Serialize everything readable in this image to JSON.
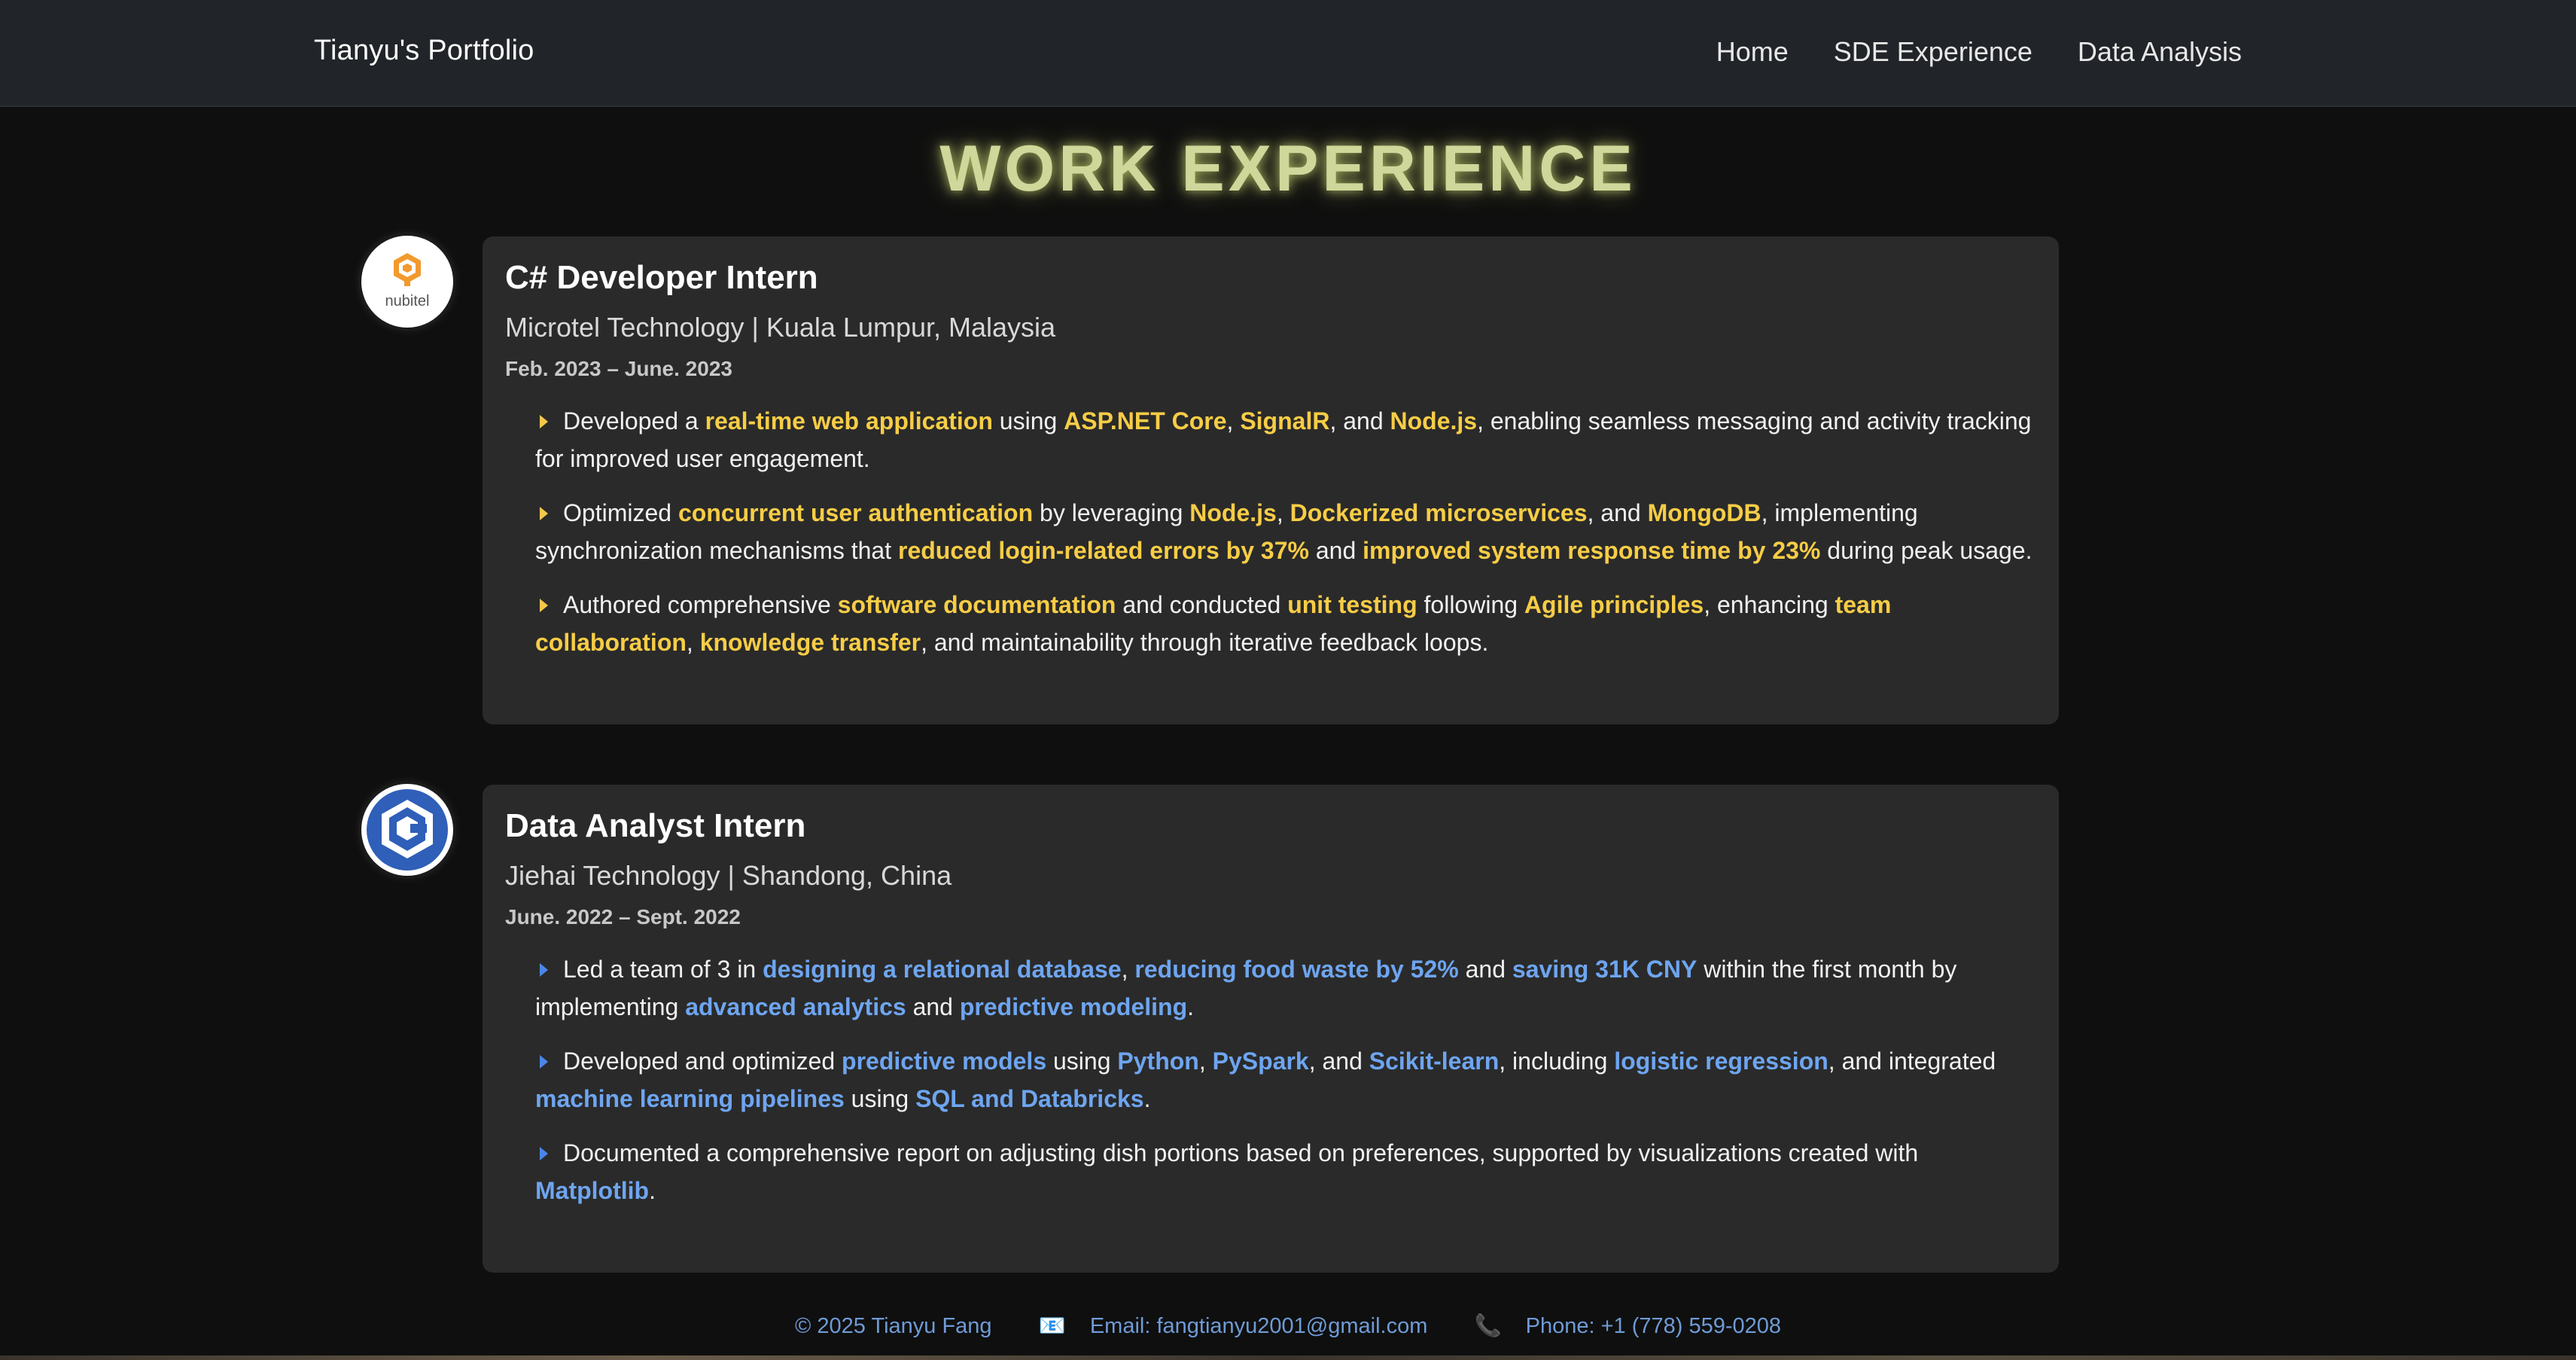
{
  "navbar": {
    "brand": "Tianyu's Portfolio",
    "links": [
      "Home",
      "SDE Experience",
      "Data Analysis"
    ]
  },
  "page": {
    "title": "WORK EXPERIENCE"
  },
  "jobs": [
    {
      "role": "C# Developer Intern",
      "company": "Microtel Technology | Kuala Lumpur, Malaysia",
      "dates": "Feb. 2023 – June. 2023",
      "logo_text": "nubitel",
      "accent": "#f7cd46",
      "bullets": [
        [
          {
            "t": "Developed a "
          },
          {
            "t": "real-time web application",
            "h": 1
          },
          {
            "t": " using "
          },
          {
            "t": "ASP.NET Core",
            "h": 1
          },
          {
            "t": ", "
          },
          {
            "t": "SignalR",
            "h": 1
          },
          {
            "t": ", and "
          },
          {
            "t": "Node.js",
            "h": 1
          },
          {
            "t": ", enabling seamless messaging and activity tracking for improved user engagement."
          }
        ],
        [
          {
            "t": "Optimized "
          },
          {
            "t": "concurrent user authentication",
            "h": 1
          },
          {
            "t": " by leveraging "
          },
          {
            "t": "Node.js",
            "h": 1
          },
          {
            "t": ", "
          },
          {
            "t": "Dockerized microservices",
            "h": 1
          },
          {
            "t": ", and "
          },
          {
            "t": "MongoDB",
            "h": 1
          },
          {
            "t": ", implementing synchronization mechanisms that "
          },
          {
            "t": "reduced login-related errors by 37%",
            "h": 1
          },
          {
            "t": " and "
          },
          {
            "t": "improved system response time by 23%",
            "h": 1
          },
          {
            "t": " during peak usage."
          }
        ],
        [
          {
            "t": "Authored comprehensive "
          },
          {
            "t": "software documentation",
            "h": 1
          },
          {
            "t": " and conducted "
          },
          {
            "t": "unit testing",
            "h": 1
          },
          {
            "t": " following "
          },
          {
            "t": "Agile principles",
            "h": 1
          },
          {
            "t": ", enhancing "
          },
          {
            "t": "team collaboration",
            "h": 1
          },
          {
            "t": ", "
          },
          {
            "t": "knowledge transfer",
            "h": 1
          },
          {
            "t": ", and maintainability through iterative feedback loops."
          }
        ]
      ]
    },
    {
      "role": "Data Analyst Intern",
      "company": "Jiehai Technology | Shandong, China",
      "dates": "June. 2022 – Sept. 2022",
      "accent": "#6ea5f0",
      "bullets": [
        [
          {
            "t": "Led a team of 3 in "
          },
          {
            "t": "designing a relational database",
            "h": 1
          },
          {
            "t": ", "
          },
          {
            "t": "reducing food waste by 52%",
            "h": 1
          },
          {
            "t": " and "
          },
          {
            "t": "saving 31K CNY",
            "h": 1
          },
          {
            "t": " within the first month by implementing "
          },
          {
            "t": "advanced analytics",
            "h": 1
          },
          {
            "t": " and "
          },
          {
            "t": "predictive modeling",
            "h": 1
          },
          {
            "t": "."
          }
        ],
        [
          {
            "t": "Developed and optimized "
          },
          {
            "t": "predictive models",
            "h": 1
          },
          {
            "t": " using "
          },
          {
            "t": "Python",
            "h": 1
          },
          {
            "t": ", "
          },
          {
            "t": "PySpark",
            "h": 1
          },
          {
            "t": ", and "
          },
          {
            "t": "Scikit-learn",
            "h": 1
          },
          {
            "t": ", including "
          },
          {
            "t": "logistic regression",
            "h": 1
          },
          {
            "t": ", and integrated "
          },
          {
            "t": "machine learning pipelines",
            "h": 1
          },
          {
            "t": " using "
          },
          {
            "t": "SQL and Databricks",
            "h": 1
          },
          {
            "t": "."
          }
        ],
        [
          {
            "t": "Documented a comprehensive report on adjusting dish portions based on preferences, supported by visualizations created with "
          },
          {
            "t": "Matplotlib",
            "h": 1
          },
          {
            "t": "."
          }
        ]
      ]
    }
  ],
  "footer": {
    "copyright": "© 2025 Tianyu Fang",
    "email_icon": "📧",
    "email": "Email: fangtianyu2001@gmail.com",
    "phone_icon": "📞",
    "phone": "Phone: +1 (778) 559-0208"
  }
}
